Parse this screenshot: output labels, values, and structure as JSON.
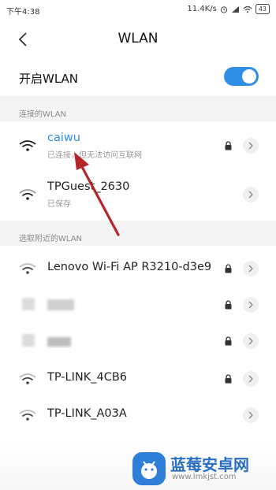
{
  "status_bar": {
    "time": "下午4:38",
    "speed": "11.4K/s",
    "battery": "43"
  },
  "header": {
    "title": "WLAN"
  },
  "wlan_toggle": {
    "label": "开启WLAN",
    "state": "on"
  },
  "connected_section": {
    "label": "连接的WLAN",
    "networks": [
      {
        "name": "caiwu",
        "status": "已连接，但无法访问互联网",
        "secured": true,
        "connected": true
      },
      {
        "name": "TPGuest_2630",
        "status": "已保存",
        "secured": false
      }
    ]
  },
  "nearby_section": {
    "label": "选取附近的WLAN",
    "networks": [
      {
        "name": "Lenovo Wi-Fi AP R3210-d3e9",
        "secured": true
      },
      {
        "name": "",
        "secured": true,
        "obscured": true
      },
      {
        "name": "",
        "secured": true,
        "obscured": true
      },
      {
        "name": "TP-LINK_4CB6",
        "secured": true
      },
      {
        "name": "TP-LINK_A03A",
        "secured": false
      }
    ]
  },
  "watermark": {
    "title": "蓝莓安卓网",
    "url": "www.lmkjst.com"
  },
  "colors": {
    "accent": "#2f8fe6",
    "annotation": "#b5262a",
    "background": "#ffffff",
    "section_bg": "#f4f4f4"
  },
  "icons": [
    "back-arrow-icon",
    "wifi-icon",
    "lock-icon",
    "chevron-right-icon",
    "alarm-icon",
    "signal-icon"
  ]
}
